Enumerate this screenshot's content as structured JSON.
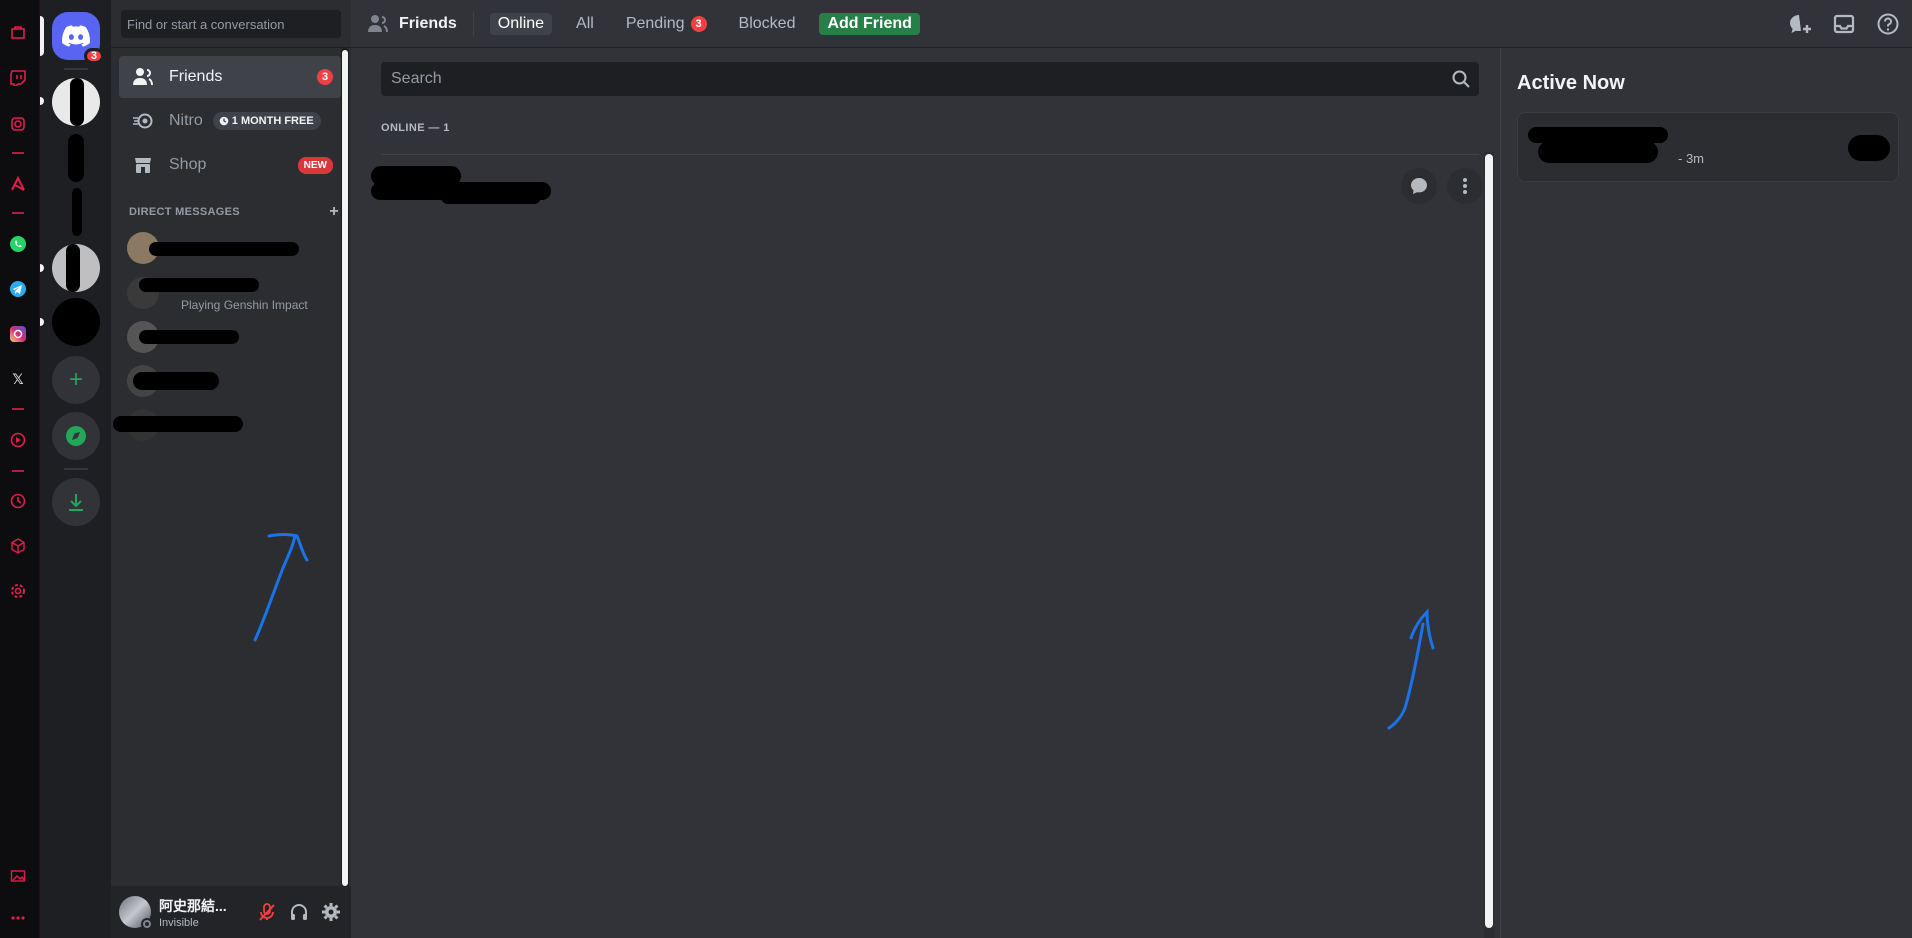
{
  "colors": {
    "accent": "#5865f2",
    "danger": "#f23f43",
    "success": "#248046",
    "browser_accent": "#e01e4b",
    "annotation": "#1a73e8"
  },
  "browser_sidebar": {
    "icons": [
      "shopping-bag-icon",
      "twitch-icon",
      "instagram-outline-icon",
      "aria-icon",
      "whatsapp-icon",
      "telegram-icon",
      "instagram-icon",
      "x-icon",
      "player-icon",
      "history-icon",
      "cube-icon",
      "settings-icon",
      "gallery-icon",
      "more-icon"
    ]
  },
  "servers": {
    "home_badge": "3"
  },
  "dm_sidebar": {
    "search_placeholder": "Find or start a conversation",
    "nav": [
      {
        "label": "Friends",
        "badge": "3"
      },
      {
        "label": "Nitro",
        "pill": "1 MONTH FREE"
      },
      {
        "label": "Shop",
        "badge": "NEW"
      }
    ],
    "direct_messages_header": "DIRECT MESSAGES",
    "add_dm": "+",
    "dm_activity": "Playing Genshin Impact"
  },
  "user_panel": {
    "name": "阿史那結...",
    "status": "Invisible"
  },
  "topbar": {
    "title": "Friends",
    "tabs": {
      "online": "Online",
      "all": "All",
      "pending": "Pending",
      "pending_badge": "3",
      "blocked": "Blocked",
      "add_friend": "Add Friend"
    }
  },
  "friends": {
    "search_placeholder": "Search",
    "online_label": "ONLINE — 1"
  },
  "active_now": {
    "title": "Active Now",
    "time": "- 3m"
  }
}
